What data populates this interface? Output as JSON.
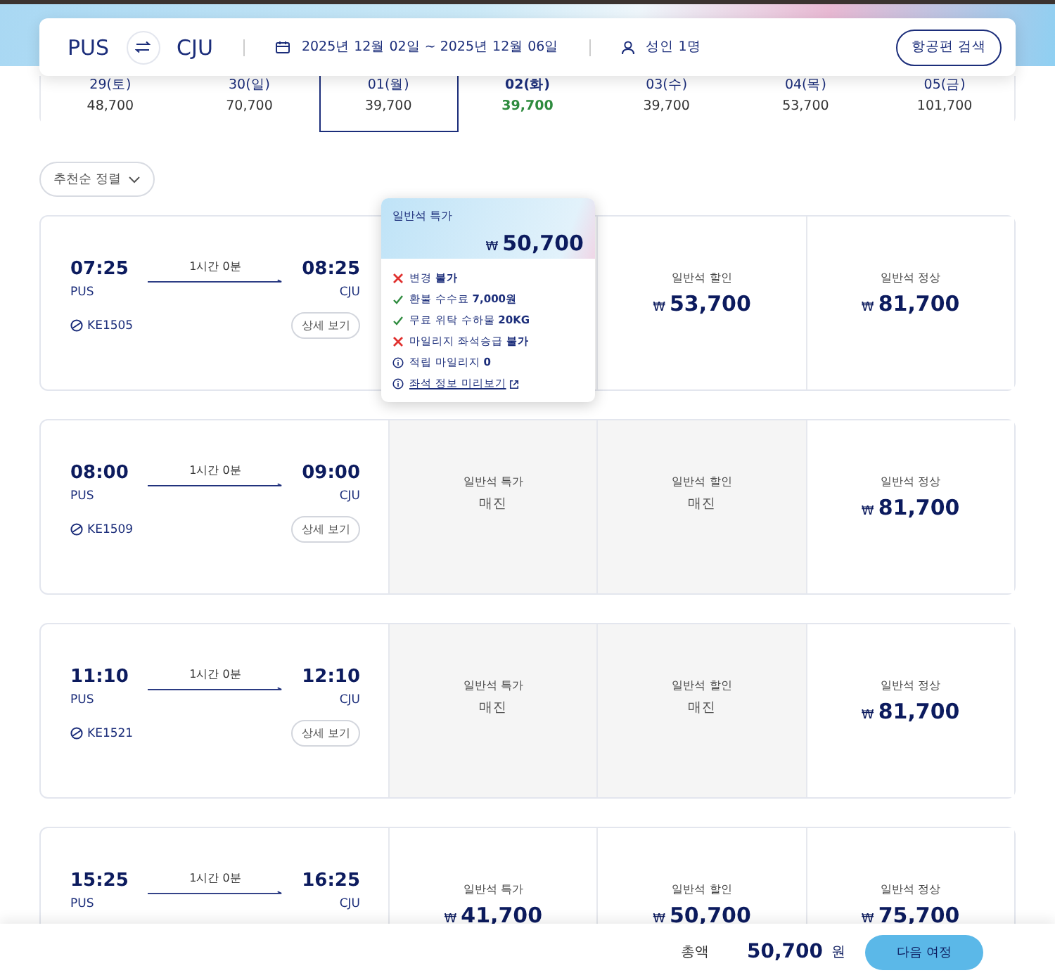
{
  "search_bar": {
    "origin": "PUS",
    "destination": "CJU",
    "dates": "2025년 12월 02일 ~ 2025년 12월 06일",
    "passengers": "성인 1명",
    "search_button": "항공편 검색"
  },
  "date_strip": [
    {
      "day": "29(토)",
      "price": "48,700",
      "selected": false,
      "current": false
    },
    {
      "day": "30(일)",
      "price": "70,700",
      "selected": false,
      "current": false
    },
    {
      "day": "01(월)",
      "price": "39,700",
      "selected": true,
      "current": false
    },
    {
      "day": "02(화)",
      "price": "39,700",
      "selected": false,
      "current": true
    },
    {
      "day": "03(수)",
      "price": "39,700",
      "selected": false,
      "current": false
    },
    {
      "day": "04(목)",
      "price": "53,700",
      "selected": false,
      "current": false
    },
    {
      "day": "05(금)",
      "price": "101,700",
      "selected": false,
      "current": false
    }
  ],
  "sort_button": "추천순 정렬",
  "flights": [
    {
      "depart": "07:25",
      "arrive": "08:25",
      "from": "PUS",
      "to": "CJU",
      "duration": "1시간 0분",
      "flight_no": "KE1505",
      "details": "상세 보기",
      "fares": [
        {
          "label": "일반석 특가",
          "currency": "₩",
          "price": "50,700",
          "sold_out": false,
          "expanded": true,
          "benefits": [
            {
              "kind": "no",
              "text": "변경 **불가**"
            },
            {
              "kind": "yes",
              "text": "환불 수수료 **7,000원**"
            },
            {
              "kind": "yes",
              "text": "무료 위탁 수하물 **20KG**"
            },
            {
              "kind": "no",
              "text": "마일리지 좌석승급 **불가**"
            },
            {
              "kind": "info",
              "text": "적립 마일리지 **0**"
            },
            {
              "kind": "link",
              "text": "좌석 정보 미리보기"
            }
          ]
        },
        {
          "label": "일반석 할인",
          "currency": "₩",
          "price": "53,700",
          "sold_out": false,
          "expanded": false
        },
        {
          "label": "일반석 정상",
          "currency": "₩",
          "price": "81,700",
          "sold_out": false,
          "expanded": false
        }
      ]
    },
    {
      "depart": "08:00",
      "arrive": "09:00",
      "from": "PUS",
      "to": "CJU",
      "duration": "1시간 0분",
      "flight_no": "KE1509",
      "details": "상세 보기",
      "fares": [
        {
          "label": "일반석 특가",
          "status": "매진",
          "sold_out": true,
          "expanded": false
        },
        {
          "label": "일반석 할인",
          "status": "매진",
          "sold_out": true,
          "expanded": false
        },
        {
          "label": "일반석 정상",
          "currency": "₩",
          "price": "81,700",
          "sold_out": false,
          "expanded": false
        }
      ]
    },
    {
      "depart": "11:10",
      "arrive": "12:10",
      "from": "PUS",
      "to": "CJU",
      "duration": "1시간 0분",
      "flight_no": "KE1521",
      "details": "상세 보기",
      "fares": [
        {
          "label": "일반석 특가",
          "status": "매진",
          "sold_out": true,
          "expanded": false
        },
        {
          "label": "일반석 할인",
          "status": "매진",
          "sold_out": true,
          "expanded": false
        },
        {
          "label": "일반석 정상",
          "currency": "₩",
          "price": "81,700",
          "sold_out": false,
          "expanded": false
        }
      ]
    },
    {
      "depart": "15:25",
      "arrive": "16:25",
      "from": "PUS",
      "to": "CJU",
      "duration": "1시간 0분",
      "fares": [
        {
          "label": "일반석 특가",
          "currency": "₩",
          "price": "41,700",
          "sold_out": false,
          "expanded": false
        },
        {
          "label": "일반석 할인",
          "currency": "₩",
          "price": "50,700",
          "sold_out": false,
          "expanded": false
        },
        {
          "label": "일반석 정상",
          "currency": "₩",
          "price": "75,700",
          "sold_out": false,
          "expanded": false
        }
      ]
    }
  ],
  "footer": {
    "total_label": "총액",
    "total": "50,700",
    "unit": "원",
    "next_button": "다음 여정"
  }
}
